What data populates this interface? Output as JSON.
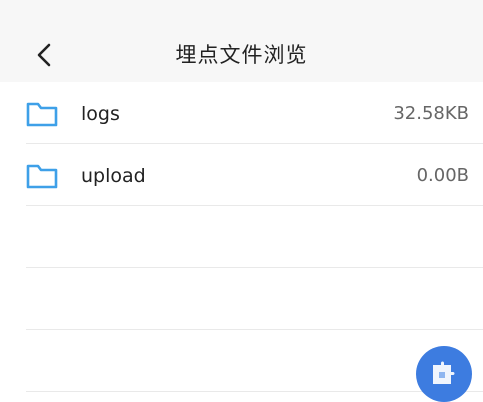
{
  "header": {
    "title": "埋点文件浏览",
    "back_icon": "chevron-left-icon"
  },
  "files": [
    {
      "icon": "folder-icon",
      "name": "logs",
      "size": "32.58KB"
    },
    {
      "icon": "folder-icon",
      "name": "upload",
      "size": "0.00B"
    }
  ],
  "colors": {
    "folder_icon": "#3ea0e8",
    "fab": "#3d7ce0",
    "header_bg": "#f7f7f7"
  },
  "fab": {
    "icon": "puzzle-piece-icon"
  }
}
